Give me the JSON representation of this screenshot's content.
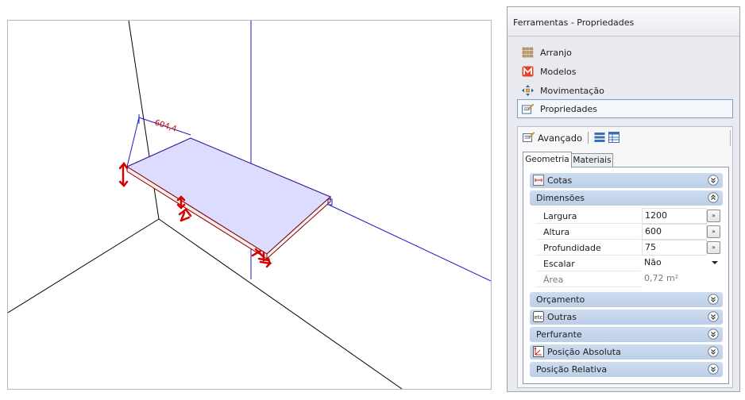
{
  "viewport": {
    "dimension_label": "604,4",
    "colors": {
      "face": "#dcdcff",
      "edge": "#800000",
      "guide": "#1a1ac8",
      "handle": "#d40000"
    }
  },
  "panel": {
    "title": "Ferramentas - Propriedades",
    "nav": [
      {
        "label": "Arranjo",
        "icon": "arranjo-grid-icon"
      },
      {
        "label": "Modelos",
        "icon": "modelos-m-icon"
      },
      {
        "label": "Movimentação",
        "icon": "move-arrows-icon"
      },
      {
        "label": "Propriedades",
        "icon": "properties-icon",
        "selected": true
      }
    ],
    "toolbar": {
      "advanced_label": "Avançado"
    },
    "tabs": [
      "Geometria",
      "Materiais"
    ],
    "groups": {
      "cotas": "Cotas",
      "dimensoes": "Dimensões",
      "orcamento": "Orçamento",
      "outras": "Outras",
      "outras_icon_text": "etc",
      "perfurante": "Perfurante",
      "posicao_absoluta": "Posição Absoluta",
      "posicao_relativa": "Posição Relativa"
    },
    "fields": {
      "largura": {
        "label": "Largura",
        "value": "1200"
      },
      "altura": {
        "label": "Altura",
        "value": "600"
      },
      "profundidade": {
        "label": "Profundidade",
        "value": "75"
      },
      "escalar": {
        "label": "Escalar",
        "value": "Não"
      },
      "area": {
        "label": "Área",
        "value": "0,72 m²"
      }
    },
    "expand_glyph": "»"
  }
}
